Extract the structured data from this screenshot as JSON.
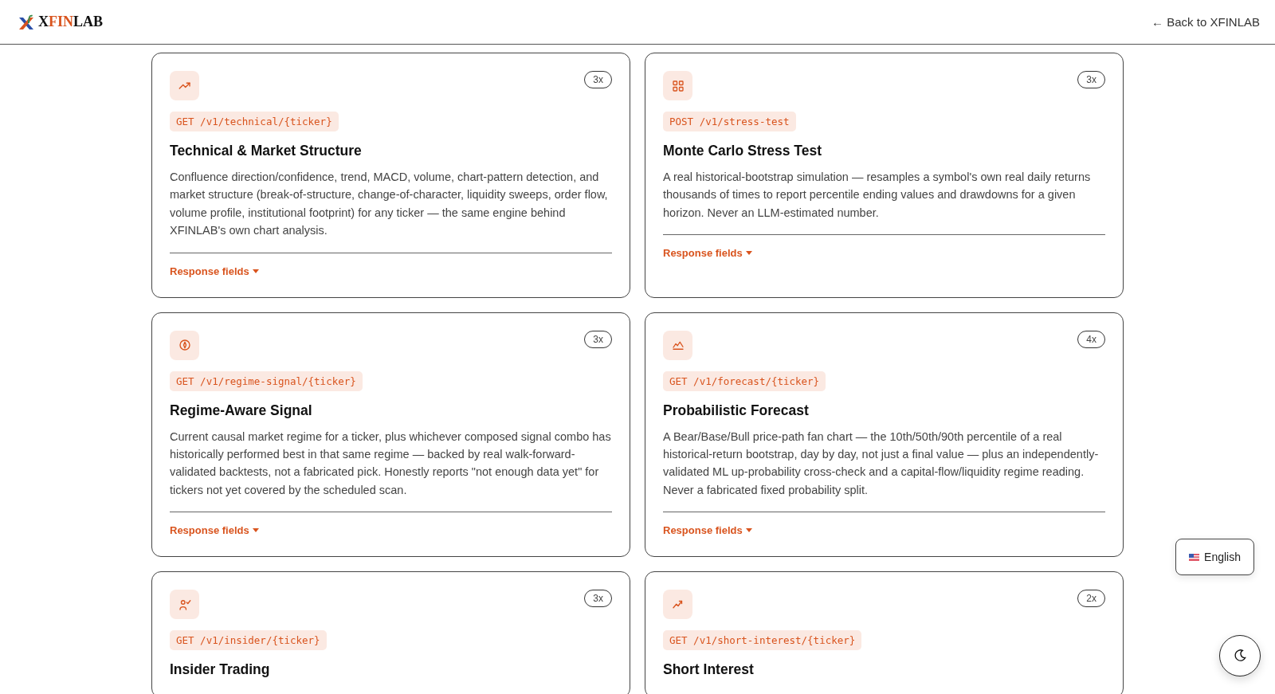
{
  "header": {
    "logo": {
      "prefix": "X",
      "middle": "FIN",
      "suffix": "LAB"
    },
    "back_link": "← Back to XFINLAB"
  },
  "cards": [
    {
      "multiplier": "3x",
      "endpoint": "GET /v1/technical/{ticker}",
      "title": "Technical & Market Structure",
      "description": "Confluence direction/confidence, trend, MACD, volume, chart-pattern detection, and market structure (break-of-structure, change-of-character, liquidity sweeps, order flow, volume profile, institutional footprint) for any ticker — the same engine behind XFINLAB's own chart analysis.",
      "response_fields": "Response fields"
    },
    {
      "multiplier": "3x",
      "endpoint": "POST /v1/stress-test",
      "title": "Monte Carlo Stress Test",
      "description": "A real historical-bootstrap simulation — resamples a symbol's own real daily returns thousands of times to report percentile ending values and drawdowns for a given horizon. Never an LLM-estimated number.",
      "response_fields": "Response fields"
    },
    {
      "multiplier": "3x",
      "endpoint": "GET /v1/regime-signal/{ticker}",
      "title": "Regime-Aware Signal",
      "description": "Current causal market regime for a ticker, plus whichever composed signal combo has historically performed best in that same regime — backed by real walk-forward-validated backtests, not a fabricated pick. Honestly reports \"not enough data yet\" for tickers not yet covered by the scheduled scan.",
      "response_fields": "Response fields"
    },
    {
      "multiplier": "4x",
      "endpoint": "GET /v1/forecast/{ticker}",
      "title": "Probabilistic Forecast",
      "description": "A Bear/Base/Bull price-path fan chart — the 10th/50th/90th percentile of a real historical-return bootstrap, day by day, not just a final value — plus an independently-validated ML up-probability cross-check and a capital-flow/liquidity regime reading. Never a fabricated fixed probability split.",
      "response_fields": "Response fields"
    },
    {
      "multiplier": "3x",
      "endpoint": "GET /v1/insider/{ticker}",
      "title": "Insider Trading"
    },
    {
      "multiplier": "2x",
      "endpoint": "GET /v1/short-interest/{ticker}",
      "title": "Short Interest"
    }
  ],
  "language_button": "English"
}
